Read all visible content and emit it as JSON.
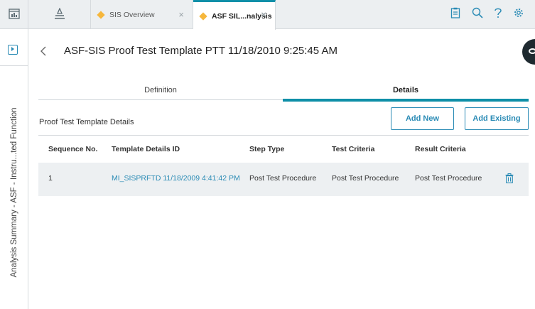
{
  "topbar": {
    "tabs": [
      {
        "label": "SIS Overview",
        "active": false
      },
      {
        "label": "ASF SIL...nalysis",
        "active": true
      }
    ],
    "close_symbol": "×",
    "accent": "#0f8fa8",
    "icon_color": "#2a8bb5"
  },
  "rail": {
    "vertical_label": "Analysis Summary - ASF - Instru...ted Function"
  },
  "page": {
    "title": "ASF-SIS Proof Test Template PTT 11/18/2010 9:25:45 AM",
    "subtabs": [
      {
        "label": "Definition",
        "active": false
      },
      {
        "label": "Details",
        "active": true
      }
    ]
  },
  "section": {
    "title": "Proof Test Template Details",
    "add_new_label": "Add New",
    "add_existing_label": "Add Existing"
  },
  "table": {
    "columns": [
      "Sequence No.",
      "Template Details ID",
      "Step Type",
      "Test Criteria",
      "Result Criteria"
    ],
    "rows": [
      {
        "sequence": "1",
        "template_id": "MI_SISPRFTD 11/18/2009 4:41:42 PM",
        "step_type": "Post Test Procedure",
        "test_criteria": "Post Test Procedure",
        "result_criteria": "Post Test Procedure"
      }
    ]
  },
  "icons": [
    "dashboard-icon",
    "hierarchy-icon",
    "diamond-icon",
    "close-icon",
    "clipboard-icon",
    "search-icon",
    "help-icon",
    "settings-icon",
    "expand-panel-icon",
    "back-chevron-icon",
    "eye-icon",
    "trash-icon"
  ]
}
